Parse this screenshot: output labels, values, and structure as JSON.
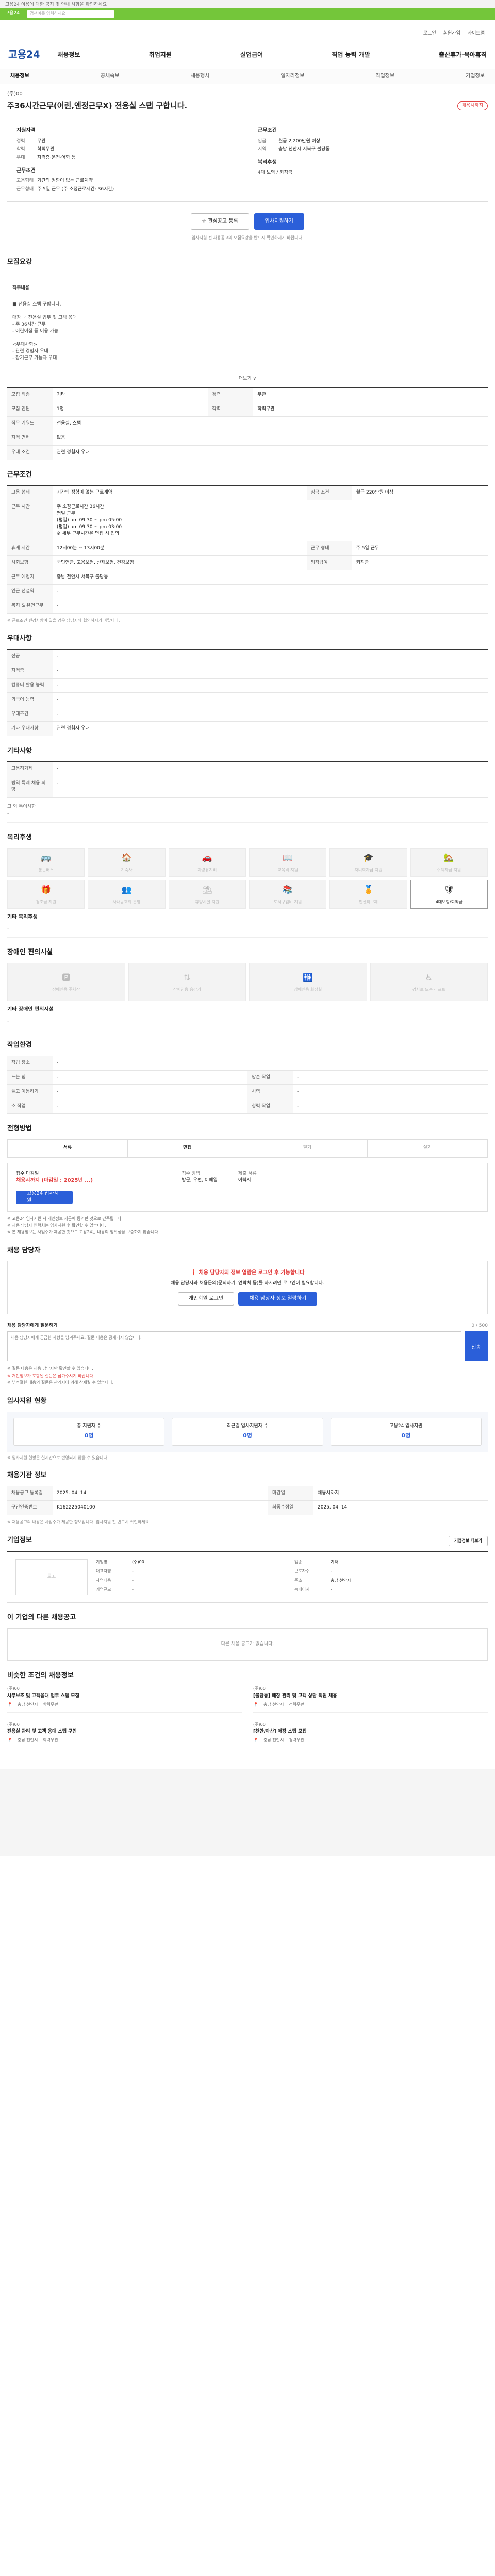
{
  "notice": "고용24 이용에 대한 공지 및 안내 사항을 확인하세요",
  "topbar": {
    "label": "고용24",
    "search_placeholder": "검색어를 입력하세요"
  },
  "util": [
    "로그인",
    "회원가입",
    "사이트맵"
  ],
  "gnb": {
    "logo": "고용24",
    "menu": [
      "채용정보",
      "취업지원",
      "실업급여",
      "직업 능력 개발",
      "출산휴가·육아휴직"
    ]
  },
  "subnav": [
    "채용정보",
    "공채속보",
    "채용행사",
    "일자리정보",
    "직업정보",
    "기업정보"
  ],
  "job": {
    "company": "(주)00",
    "title": "주36시간근무(어린,엔정근무X) 전용실 스탭 구합니다.",
    "status": "채용시까지"
  },
  "summary": {
    "left_head": "지원자격",
    "left": [
      [
        "경력",
        "무관"
      ],
      [
        "학력",
        "학력무관"
      ],
      [
        "우대",
        "자격증·운전·어학 등"
      ]
    ],
    "left_head2": "근무조건",
    "left2": [
      [
        "고용형태",
        "기간의 정함이 없는 근로계약"
      ],
      [
        "근무형태",
        "주 5일 근무 (주 소정근로시간: 36시간)"
      ]
    ],
    "right_head": "근무조건",
    "right": [
      [
        "임금",
        "월급 2,200만원 이상"
      ],
      [
        "지역",
        "충남 천안시 서북구 불당동"
      ]
    ],
    "right_head2": "복리후생",
    "right2": [
      [
        "",
        "4대 보험 / 퇴직금"
      ]
    ]
  },
  "buttons": {
    "save": "관심공고 등록",
    "apply": "입사지원하기"
  },
  "small_note": "입사지원 전 채용공고의 모집요강을 반드시 확인하시기 바랍니다.",
  "sections": {
    "summary_title": "모집요강",
    "job_desc_head": "직무내용",
    "job_desc": "■ 전용실 스탭 구합니다.\n\n매장 내 전용실 업무 및 고객 응대\n- 주 36시간 근무\n- 어린이집 등 이용 가능\n\n<우대사항>\n- 관련 경험자 우대\n- 장기근무 가능자 우대",
    "more": "더보기 ∨",
    "info_rows": [
      [
        "모집 직종",
        "기타",
        "경력",
        "무관"
      ],
      [
        "모집 인원",
        "1명",
        "학력",
        "학력무관"
      ],
      [
        "직무 키워드",
        "전용실, 스탭",
        "",
        ""
      ],
      [
        "자격 면허",
        "없음",
        "",
        ""
      ],
      [
        "우대 조건",
        "관련 경험자 우대",
        "",
        ""
      ]
    ],
    "work_title": "근무조건",
    "work_rows": [
      [
        "고용 형태",
        "기간의 정함이 없는 근로계약",
        "임금 조건",
        "월급 220만원 이상"
      ],
      [
        "근무 시간",
        "주 소정근로시간 36시간\n평일 근무\n(평일) am 09:30 ~ pm 05:00\n(평일) am 09:30 ~ pm 03:00\n※ 세부 근무시간은 면접 시 협의",
        "",
        ""
      ],
      [
        "휴게 시간",
        "12시00분 ~ 13시00분",
        "근무 형태",
        "주 5일 근무"
      ],
      [
        "사회보험",
        "국민연금, 고용보험, 산재보험, 건강보험",
        "퇴직급여",
        "퇴직금"
      ],
      [
        "근무 예정지",
        "충남 천안시 서북구 불당동",
        "",
        ""
      ],
      [
        "인근 전철역",
        "-",
        "",
        ""
      ],
      [
        "복지 & 유연근무",
        "-",
        "",
        ""
      ]
    ],
    "work_note": "※ 근로조건 변경사항이 있을 경우 담당자와 협의하시기 바랍니다.",
    "qual_title": "우대사항",
    "qual_rows": [
      [
        "전공",
        "-"
      ],
      [
        "자격증",
        "-"
      ],
      [
        "컴퓨터 활용 능력",
        "-"
      ],
      [
        "외국어 능력",
        "-"
      ],
      [
        "우대조건",
        "-"
      ],
      [
        "기타 우대사항",
        "관련 경험자 우대"
      ]
    ],
    "hire_title": "기타사항",
    "hire_rows": [
      [
        "고용허가제",
        "-"
      ],
      [
        "병역 특례 채용 희망",
        "-"
      ]
    ],
    "hire_note": "그 외 특이사항\n-",
    "welfare_title": "복리후생",
    "welfare_icons": [
      "통근버스",
      "기숙사",
      "차량유지비",
      "교육비 지원",
      "자녀학자금 지원",
      "주택자금 지원",
      "경조금 지원",
      "사내동호회 운영",
      "휴양시설 지원",
      "도서구입비 지원",
      "인센티브제",
      "4대보험/퇴직금"
    ],
    "welfare_other_head": "기타 복리후생",
    "welfare_other": "-",
    "disable_title": "장애인 편의시설",
    "disable_icons": [
      "장애인용 주차장",
      "장애인용 승강기",
      "장애인용 화장실",
      "경사로 또는 리프트"
    ],
    "disable_other_head": "기타 장애인 편의시설",
    "disable_other": "-",
    "env_title": "작업환경",
    "env_rows": [
      [
        "작업 장소",
        "-",
        "",
        ""
      ],
      [
        "드는 힘",
        "-",
        "양손 작업",
        "-"
      ],
      [
        "들고 이동하기",
        "-",
        "시력",
        "-"
      ],
      [
        "소 작업",
        "-",
        "청력 작업",
        "-"
      ]
    ],
    "process_title": "전형방법",
    "process_steps": [
      "서류",
      "면접",
      "필기",
      "실기"
    ],
    "apply_deadline_head": "접수 마감일",
    "apply_deadline": "채용시까지 (마감일 : 2025년 ...)",
    "apply_method_head": "접수 방법",
    "apply_method": "방문, 우편, 이메일",
    "apply_docs_head": "제출 서류",
    "apply_docs": "이력서",
    "apply_btn": "고용24 입사지원",
    "process_notes": [
      "※ 고용24 입사지원 시 개인정보 제공에 동의한 것으로 간주됩니다.",
      "※ 채용 담당자 연락처는 입사지원 후 확인할 수 있습니다.",
      "※ 본 채용정보는 사업주가 제공한 것으로 고용24는 내용의 정확성을 보증하지 않습니다."
    ],
    "contact_title": "채용 담당자",
    "contact_box_title": "채용 담당자의 정보 열람은 로그인 후 가능합니다",
    "contact_box_text": "채용 담당자와 채용문의(문의하기, 연락처 등)를 하시려면 로그인이 필요합니다.",
    "contact_btns": [
      "개인회원 로그인",
      "채용 담당자 정보 열람하기"
    ],
    "qa_head": "채용 담당자에게 질문하기",
    "qa_count": "0 / 500",
    "qa_placeholder": "채용 담당자에게 궁금한 사항을 남겨주세요. 질문 내용은 공개되지 않습니다.",
    "qa_submit": "전송",
    "qa_notes": [
      "※ 질문 내용은 채용 담당자만 확인할 수 있습니다.",
      "※ 개인정보가 포함된 질문은 삼가주시기 바랍니다.",
      "※ 부적절한 내용의 질문은 관리자에 의해 삭제될 수 있습니다."
    ],
    "stats_title": "입사지원 현황",
    "stats": [
      [
        "총 지원자 수",
        "0명"
      ],
      [
        "최근일 입사지원자 수",
        "0명"
      ],
      [
        "고용24 입사지원",
        "0명"
      ]
    ],
    "stats_note": "※ 입사지원 현황은 실시간으로 반영되지 않을 수 있습니다.",
    "org_title": "채용기관 정보",
    "org_rows": [
      [
        "채용공고 등록일",
        "2025. 04. 14",
        "마감일",
        "채용시까지"
      ],
      [
        "구인인증번호",
        "K162225040100",
        "최종수정일",
        "2025. 04. 14"
      ]
    ],
    "org_note": "※ 채용공고의 내용은 사업주가 제공한 정보입니다. 입사지원 전 반드시 확인하세요.",
    "company_title": "기업정보",
    "company_logo": "로고",
    "company_kv": [
      [
        "기업명",
        "(주)00"
      ],
      [
        "업종",
        "기타"
      ],
      [
        "대표자명",
        "-"
      ],
      [
        "근로자수",
        "-"
      ],
      [
        "사업내용",
        "-"
      ],
      [
        "주소",
        "충남 천안시"
      ],
      [
        "기업규모",
        "-"
      ],
      [
        "홈페이지",
        "-"
      ]
    ],
    "company_btn": "기업정보 더보기",
    "similar_title": "이 기업의 다른 채용공고",
    "similar_empty": "다른 채용 공고가 없습니다.",
    "rec_title": "비슷한 조건의 채용정보",
    "rec": [
      {
        "co": "(주)00",
        "t": "사무보조 및 고객응대 업무 스탭 모집",
        "meta": [
          "충남 천안시",
          "학력무관"
        ]
      },
      {
        "co": "(주)00",
        "t": "[불당동] 매장 관리 및 고객 상담 직원 채용",
        "meta": [
          "충남 천안시",
          "경력무관"
        ]
      },
      {
        "co": "(주)00",
        "t": "전용실 관리 및 고객 응대 스탭 구인",
        "meta": [
          "충남 천안시",
          "학력무관"
        ]
      },
      {
        "co": "(주)00",
        "t": "[천안/아산] 매장 스탭 모집",
        "meta": [
          "충남 천안시",
          "경력무관"
        ]
      }
    ]
  }
}
